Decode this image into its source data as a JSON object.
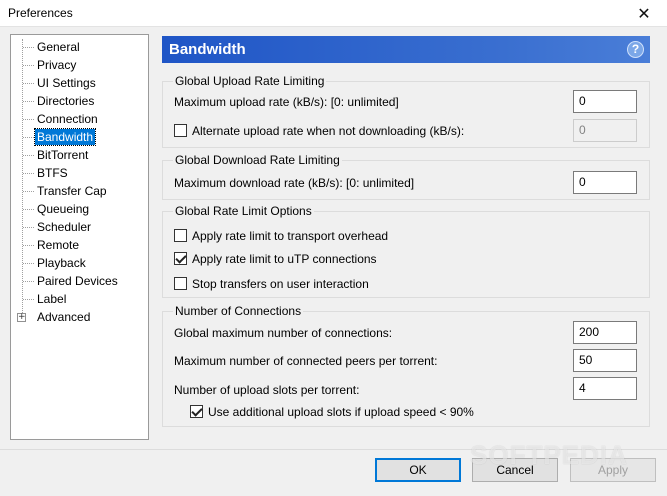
{
  "window": {
    "title": "Preferences",
    "close_glyph": "✕"
  },
  "tree": {
    "items": [
      {
        "label": "General",
        "selected": false
      },
      {
        "label": "Privacy",
        "selected": false
      },
      {
        "label": "UI Settings",
        "selected": false
      },
      {
        "label": "Directories",
        "selected": false
      },
      {
        "label": "Connection",
        "selected": false
      },
      {
        "label": "Bandwidth",
        "selected": true
      },
      {
        "label": "BitTorrent",
        "selected": false
      },
      {
        "label": "BTFS",
        "selected": false
      },
      {
        "label": "Transfer Cap",
        "selected": false
      },
      {
        "label": "Queueing",
        "selected": false
      },
      {
        "label": "Scheduler",
        "selected": false
      },
      {
        "label": "Remote",
        "selected": false
      },
      {
        "label": "Playback",
        "selected": false
      },
      {
        "label": "Paired Devices",
        "selected": false
      },
      {
        "label": "Label",
        "selected": false
      },
      {
        "label": "Advanced",
        "selected": false,
        "expandable": true
      }
    ],
    "expander_glyph": "+"
  },
  "panel": {
    "title": "Bandwidth",
    "help_glyph": "?"
  },
  "upload": {
    "legend": "Global Upload Rate Limiting",
    "max_label": "Maximum upload rate (kB/s): [0: unlimited]",
    "max_value": "0",
    "alt_label": "Alternate upload rate when not downloading (kB/s):",
    "alt_checked": false,
    "alt_value": "0"
  },
  "download": {
    "legend": "Global Download Rate Limiting",
    "max_label": "Maximum download rate (kB/s): [0: unlimited]",
    "max_value": "0"
  },
  "options": {
    "legend": "Global Rate Limit Options",
    "transport_label": "Apply rate limit to transport overhead",
    "transport_checked": false,
    "utp_label": "Apply rate limit to uTP connections",
    "utp_checked": true,
    "stop_label": "Stop transfers on user interaction",
    "stop_checked": false
  },
  "connections": {
    "legend": "Number of Connections",
    "global_label": "Global maximum number of connections:",
    "global_value": "200",
    "peers_label": "Maximum number of connected peers per torrent:",
    "peers_value": "50",
    "slots_label": "Number of upload slots per torrent:",
    "slots_value": "4",
    "additional_label": "Use additional upload slots if upload speed < 90%",
    "additional_checked": true
  },
  "buttons": {
    "ok": "OK",
    "cancel": "Cancel",
    "apply": "Apply"
  },
  "watermark": "SOFTPEDIA"
}
